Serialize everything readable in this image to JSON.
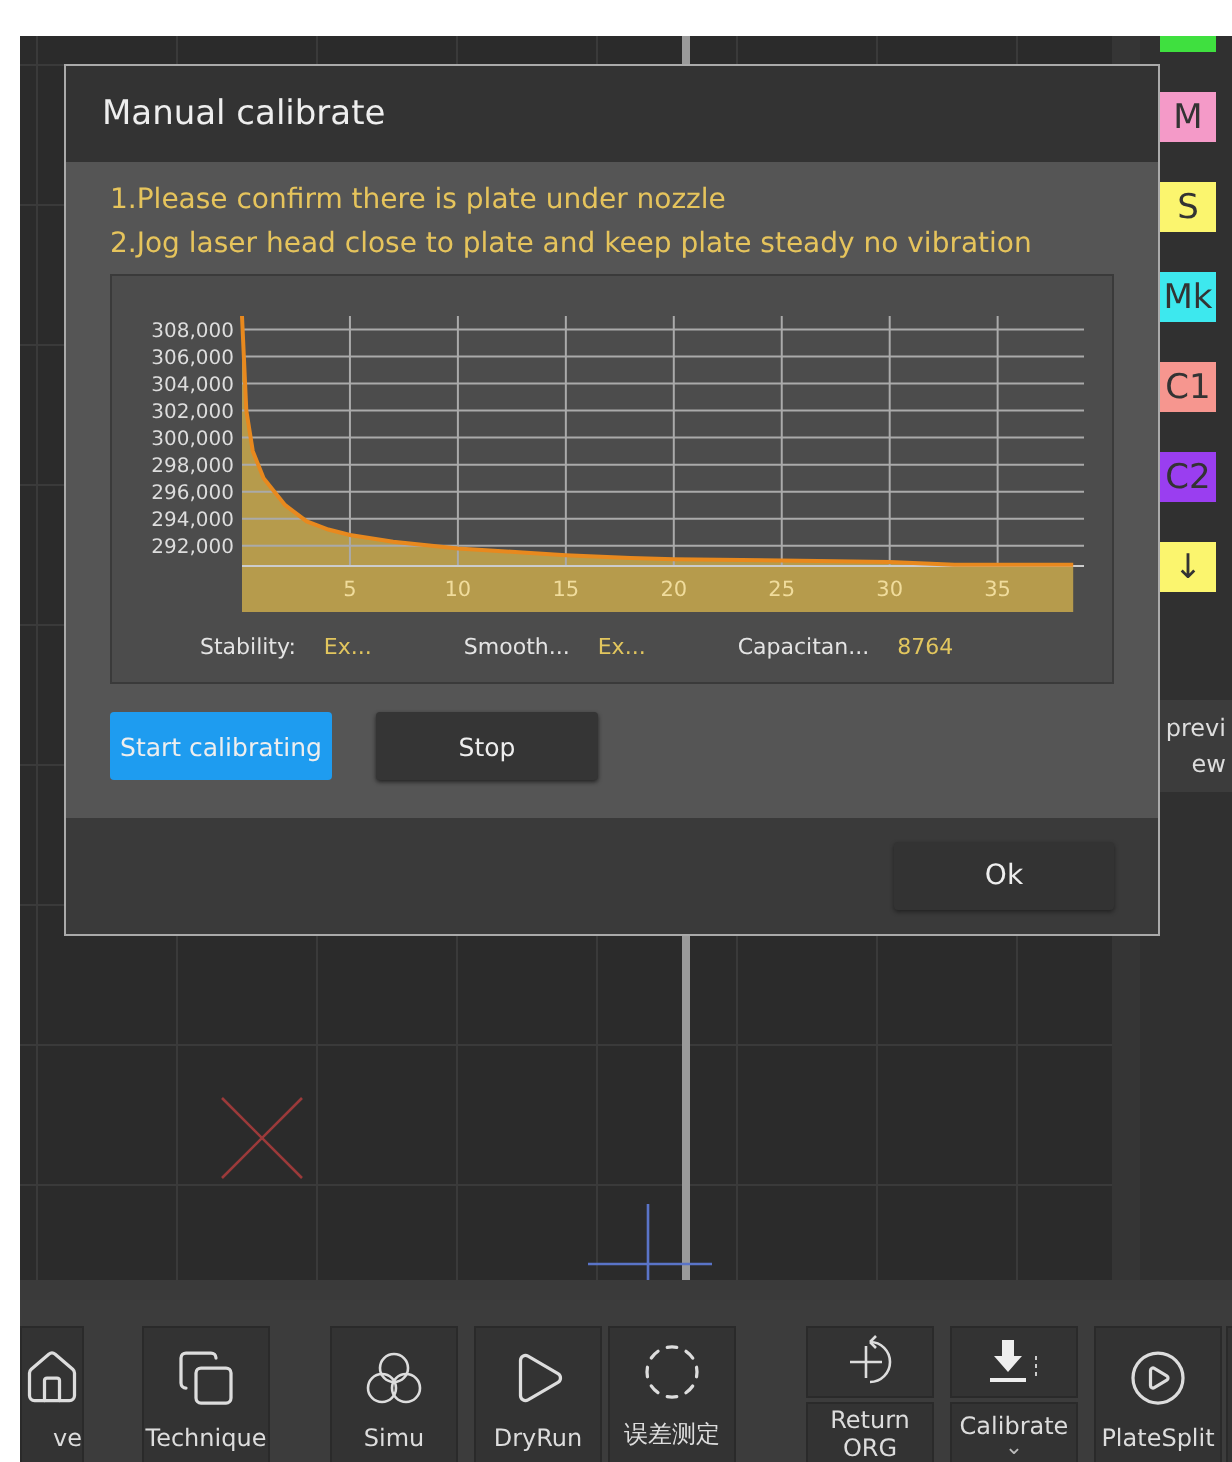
{
  "dialog": {
    "title": "Manual calibrate",
    "instructions": [
      "1.Please confirm there is plate under nozzle",
      "2.Jog laser head close to plate and keep plate steady no vibration"
    ],
    "chart_data": {
      "type": "area",
      "x": [
        0,
        0.2,
        0.5,
        1,
        2,
        3,
        4,
        5,
        7,
        10,
        13,
        15,
        18,
        20,
        25,
        30,
        33,
        38.5
      ],
      "grid": true,
      "series": [
        {
          "color": "#e8891e",
          "values": [
            309000,
            302000,
            299000,
            297000,
            295000,
            293800,
            293200,
            292800,
            292300,
            291800,
            291500,
            291300,
            291100,
            291000,
            290900,
            290800,
            290600,
            290600
          ]
        }
      ],
      "xlim": [
        0,
        39
      ],
      "ylim": [
        290500,
        309000
      ],
      "xticks": [
        5,
        10,
        15,
        20,
        25,
        30,
        35
      ],
      "yticks": [
        {
          "value": 292000,
          "label": "292,000"
        },
        {
          "value": 294000,
          "label": "294,000"
        },
        {
          "value": 296000,
          "label": "296,000"
        },
        {
          "value": 298000,
          "label": "298,000"
        },
        {
          "value": 300000,
          "label": "300,000"
        },
        {
          "value": 302000,
          "label": "302,000"
        },
        {
          "value": 304000,
          "label": "304,000"
        },
        {
          "value": 306000,
          "label": "306,000"
        },
        {
          "value": 308000,
          "label": "308,000"
        }
      ]
    },
    "stats": [
      {
        "label": "Stability:",
        "value": "Ex..."
      },
      {
        "label": "Smooth...",
        "value": "Ex..."
      },
      {
        "label": "Capacitan...",
        "value": "8764"
      }
    ],
    "actions": [
      {
        "label": "Start calibrating",
        "selected": true
      },
      {
        "label": "Stop",
        "selected": false
      }
    ],
    "ok": "Ok"
  },
  "layer_tags": [
    {
      "color": "#3fe03f"
    },
    {
      "label": "M",
      "color": "#f49ac8"
    },
    {
      "label": "S",
      "color": "#fbf56e"
    },
    {
      "label": "Mk",
      "color": "#3de8ee"
    },
    {
      "label": "C1",
      "color": "#f6968f"
    },
    {
      "label": "C2",
      "color": "#9a3ef0"
    },
    {
      "label": "↓",
      "color": "#fbf56e"
    }
  ],
  "preview_button": [
    "previ",
    "ew"
  ],
  "toolbar": [
    {
      "kind": "single",
      "label": "ve"
    },
    {
      "kind": "single",
      "label": "Technique"
    },
    {
      "kind": "single",
      "label": "Simu"
    },
    {
      "kind": "single",
      "label": "DryRun"
    },
    {
      "kind": "single",
      "label": "误差测定"
    },
    {
      "kind": "split",
      "label": "Return\nORG"
    },
    {
      "kind": "split",
      "label": "Calibrate",
      "caret": "⌄"
    },
    {
      "kind": "single",
      "label": "PlateSplit"
    },
    {
      "kind": "cut"
    }
  ]
}
